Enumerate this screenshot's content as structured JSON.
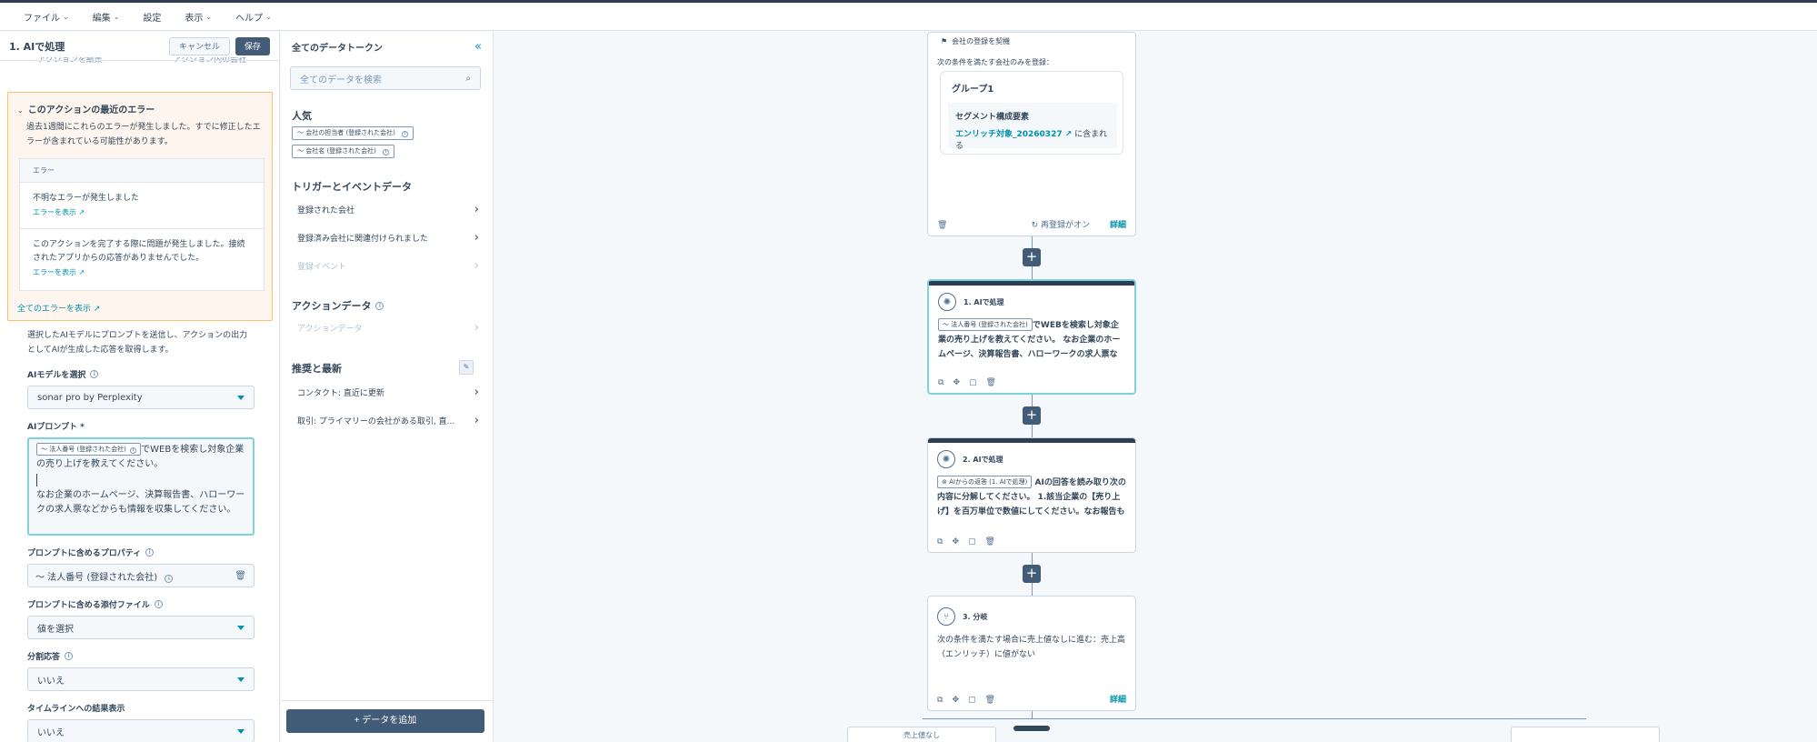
{
  "menu": [
    "ファイル",
    "編集",
    "設定",
    "表示",
    "ヘルプ"
  ],
  "left": {
    "title": "1. AIで処理",
    "cancel": "キャンセル",
    "save": "保存",
    "tabs": [
      "アクションを編集",
      "アクション内の会社"
    ],
    "error_section": {
      "title": "このアクションの最近のエラー",
      "desc": "過去1週間にこれらのエラーが発生しました。すでに修正したエラーが含まれている可能性があります。",
      "col": "エラー",
      "rows": [
        {
          "msg": "不明なエラーが発生しました",
          "link": "エラーを表示 ↗"
        },
        {
          "msg": "このアクションを完了する際に問題が発生しました。接続されたアプリからの応答がありませんでした。",
          "link": "エラーを表示 ↗"
        }
      ],
      "all": "全てのエラーを表示 ↗"
    },
    "desc": "選択したAIモデルにプロンプトを送信し、アクションの出力としてAIが生成した応答を取得します。",
    "model_label": "AIモデルを選択",
    "model_value": "sonar pro by Perplexity",
    "prompt_label": "AIプロンプト *",
    "prompt_token": "〜 法人番号 (登録された会社)",
    "prompt_text1": "でWEBを検索し対象企業の売り上げを教えてください。",
    "prompt_text2": "なお企業のホームページ、決算報告書、ハローワークの求人票などからも情報を収集してください。",
    "props_label": "プロンプトに含めるプロパティ",
    "props_value": "〜 法人番号 (登録された会社)",
    "attach_label": "プロンプトに含める添付ファイル",
    "attach_value": "値を選択",
    "split_label": "分割応答",
    "split_value": "いいえ",
    "timeline_label": "タイムラインへの結果表示",
    "timeline_value": "いいえ"
  },
  "mid": {
    "title": "全てのデータトークン",
    "search_placeholder": "全てのデータを検索",
    "popular": "人気",
    "popular_tokens": [
      "〜 会社の担当者 (登録された会社)",
      "〜 会社名 (登録された会社)"
    ],
    "trigger": "トリガーとイベントデータ",
    "trigger_items": [
      "登録された会社",
      "登録済み会社に関連付けられました",
      "登録イベント"
    ],
    "action": "アクションデータ",
    "action_items": [
      "アクションデータ"
    ],
    "recommended": "推奨と最新",
    "recommended_items": [
      "コンタクト: 直近に更新",
      "取引: プライマリーの会社がある取引, 直..."
    ],
    "add_data": "+ データを追加"
  },
  "canvas": {
    "enroll_card": {
      "head": "会社の登録を契機",
      "condition": "次の条件を満たす会社のみを登録：",
      "group": "グループ1",
      "segment": "セグメント構成要素",
      "segment_link": "エンリッチ対象_20260327 ↗",
      "segment_suffix": "に含まれる",
      "reenroll": "再登録がオン",
      "detail": "詳細"
    },
    "ai1": {
      "title": "1. AIで処理",
      "token": "〜 法人番号 (登録された会社)",
      "text": "でWEBを検索し対象企業の売り上げを教えてください。 なお企業のホームページ、決算報告書、ハローワークの求人票などからも情報を収集してください。 AIに送信"
    },
    "ai2": {
      "title": "2. AIで処理",
      "token": "⊚ AIからの返答 (1. AIで処理)",
      "text": "AIの回答を読み取り次の内容に分解してください。 1.該当企業の【売り上げ】を百万単位で数値にしてください。なお報告もしくは関連する情報が取得できない場"
    },
    "branch": {
      "title": "3. 分岐",
      "text": "次の条件を満たす場合に売上値なしに進む：売上高（エンリッチ）に値がない",
      "detail": "詳細"
    },
    "bottom_left": "売上値なし"
  }
}
